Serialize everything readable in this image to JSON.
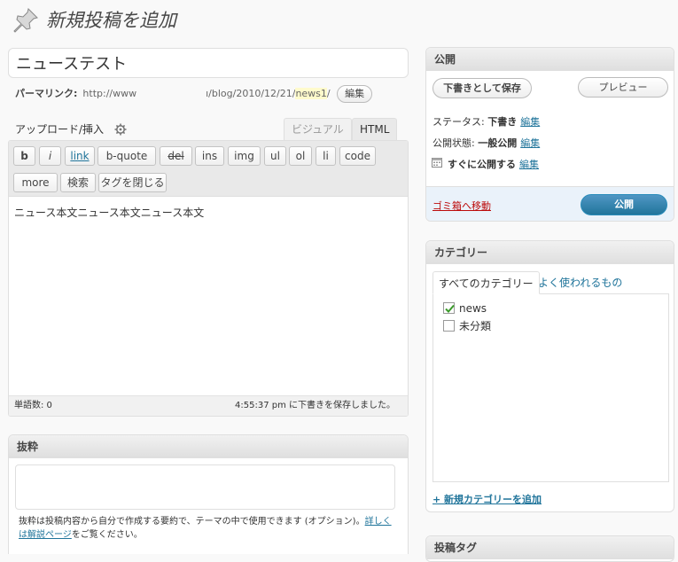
{
  "header": {
    "title": "新規投稿を追加",
    "icon": "pushpin-icon"
  },
  "post": {
    "title_value": "ニューステスト",
    "permalink_label": "パーマリンク:",
    "permalink_prefix": "http://www",
    "permalink_path": "ı/blog/2010/12/21/",
    "permalink_slug": "news1",
    "permalink_suffix": "/",
    "permalink_edit": "編集"
  },
  "editor": {
    "upload_label": "アップロード/挿入",
    "tab_visual": "ビジュアル",
    "tab_html": "HTML",
    "quicktags": [
      "b",
      "i",
      "link",
      "b-quote",
      "del",
      "ins",
      "img",
      "ul",
      "ol",
      "li",
      "code",
      "more",
      "検索",
      "タグを閉じる"
    ],
    "content": "ニュース本文ニュース本文ニュース本文",
    "word_count": "単語数: 0",
    "autosave": "4:55:37 pm に下書きを保存しました。"
  },
  "excerpt": {
    "title": "抜粋",
    "help_text": "抜粋は投稿内容から自分で作成する要約で、テーマの中で使用できます (オプション)。",
    "help_link": "詳しくは解説ページ",
    "help_suffix": "をご覧ください。"
  },
  "publish": {
    "title": "公開",
    "save_draft": "下書きとして保存",
    "preview": "プレビュー",
    "status_label": "ステータス: ",
    "status_value": "下書き",
    "visibility_label": "公開状態: ",
    "visibility_value": "一般公開",
    "schedule_value": "すぐに公開する",
    "edit": "編集",
    "trash": "ゴミ箱へ移動",
    "publish_button": "公開"
  },
  "categories": {
    "title": "カテゴリー",
    "tab_all": "すべてのカテゴリー",
    "tab_popular": "よく使われるもの",
    "items": [
      {
        "label": "news",
        "checked": true
      },
      {
        "label": "未分類",
        "checked": false
      }
    ],
    "add_new": "+ 新規カテゴリーを追加"
  },
  "tags": {
    "title": "投稿タグ"
  },
  "colors": {
    "link": "#21759b",
    "publish_button": "#21759b",
    "trash": "#bc0b0b",
    "check": "#3a9a2a"
  }
}
